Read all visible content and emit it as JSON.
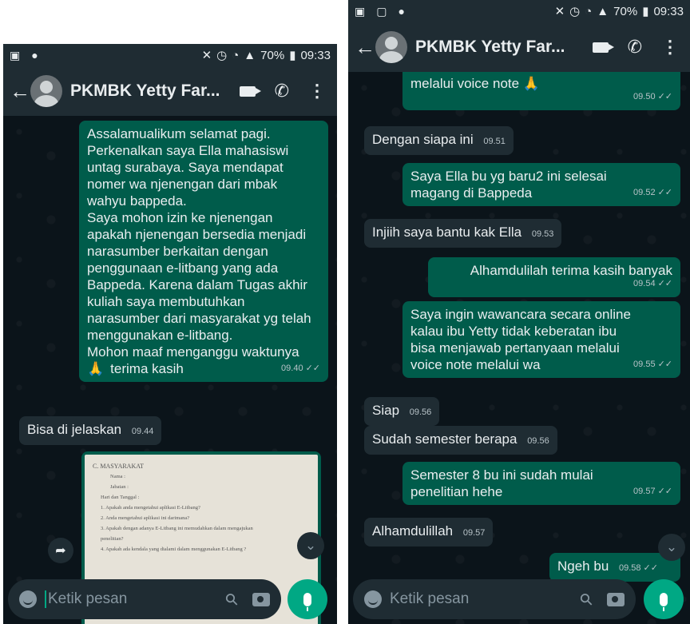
{
  "status_bar": {
    "battery": "70%",
    "time": "09:33"
  },
  "chat_header": {
    "contact_name": "PKMBK Yetty Far..."
  },
  "left_screen": {
    "messages": [
      {
        "direction": "outgoing",
        "lines": [
          "Assalamualikum selamat pagi.",
          "Perkenalkan saya Ella mahasiswi",
          "untag surabaya. Saya mendapat",
          "nomer wa njenengan dari mbak",
          "wahyu bappeda.",
          "Saya mohon izin ke njenengan",
          "apakah njenengan bersedia menjadi",
          "narasumber berkaitan dengan",
          "penggunaan e-litbang yang ada",
          "Bappeda. Karena dalam Tugas akhir",
          "kuliah saya membutuhkan",
          "narasumber dari masyarakat yg telah",
          "menggunakan e-litbang.",
          "Mohon maaf menganggu waktunya"
        ],
        "last_line": "terima kasih",
        "time": "09.40"
      },
      {
        "direction": "incoming",
        "text": "Bisa di jelaskan",
        "time": "09.44"
      }
    ],
    "image_message": {
      "lines": [
        "C. MASYARAKAT",
        "Nama            :",
        "Jabatan         :",
        "Hari dan Tanggal :",
        "1.  Apakah anda mengetahui aplikasi E-Litbang?",
        "2.  Anda mengetahui aplikasi ini darimana?",
        "3.  Apakah dengan adanya E-Litbang ini memudahkan dalam mengajukan",
        "      penelitian?",
        "4.  Apakah ada kendala yang dialami dalam menggunakan E-Litbang ?"
      ]
    }
  },
  "right_screen": {
    "messages": [
      {
        "direction": "outgoing",
        "text": "melalui voice note",
        "time": "09.50"
      },
      {
        "direction": "incoming",
        "text": "Dengan siapa ini",
        "time": "09.51"
      },
      {
        "direction": "outgoing",
        "lines": [
          "Saya Ella bu yg baru2 ini selesai"
        ],
        "last_line": "magang di Bappeda",
        "time": "09.52"
      },
      {
        "direction": "incoming",
        "text": "Injiih saya bantu kak Ella",
        "time": "09.53"
      },
      {
        "direction": "outgoing",
        "text": "Alhamdulilah terima kasih banyak",
        "time": "09.54"
      },
      {
        "direction": "outgoing",
        "lines": [
          "Saya ingin wawancara secara online",
          "kalau ibu Yetty tidak keberatan ibu",
          "bisa menjawab pertanyaan melalui"
        ],
        "last_line": "voice note melalui wa",
        "time": "09.55"
      },
      {
        "direction": "incoming",
        "text": "Siap",
        "time": "09.56"
      },
      {
        "direction": "incoming",
        "text": "Sudah semester berapa",
        "time": "09.56"
      },
      {
        "direction": "outgoing",
        "lines": [
          "Semester 8 bu ini sudah mulai"
        ],
        "last_line": "penelitian hehe",
        "time": "09.57"
      },
      {
        "direction": "incoming",
        "text": "Alhamdulillah",
        "time": "09.57"
      },
      {
        "direction": "outgoing",
        "text": "Ngeh bu",
        "time": "09.58"
      }
    ]
  },
  "input_bar": {
    "placeholder": "Ketik pesan"
  },
  "icons": {
    "read_ticks": "double-check-icon",
    "emoji": "folded-hands-emoji"
  },
  "colors": {
    "outgoing_bubble": "#005c4b",
    "incoming_bubble": "#1f2c33",
    "accent": "#00a884"
  }
}
